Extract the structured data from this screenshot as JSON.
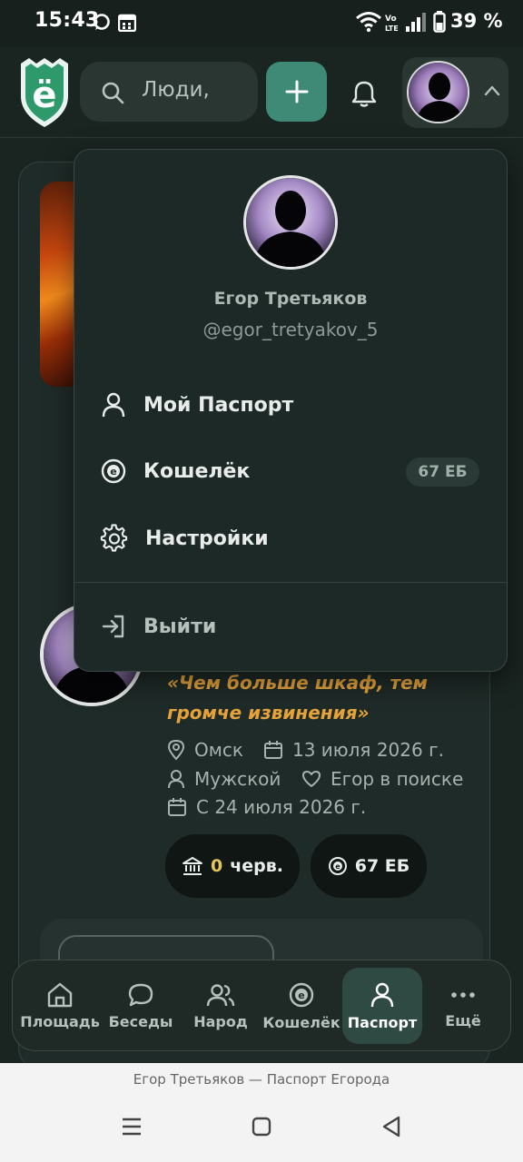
{
  "status_bar": {
    "time": "15:43",
    "battery": "39 %"
  },
  "header": {
    "search_placeholder": "Люди,",
    "logo_letter": "ё"
  },
  "profile": {
    "quote": "«Чем больше шкаф, тем громче извинения»",
    "city": "Омск",
    "date": "13 июля 2026 г.",
    "gender": "Мужской",
    "looking_for": "Егор в поиске",
    "since": "С 24 июля 2026 г.",
    "treasury_value": "0",
    "treasury_unit": "черв.",
    "wallet_balance": "67 ЕБ"
  },
  "dropdown": {
    "name": "Егор Третьяков",
    "handle": "@egor_tretyakov_5",
    "items": [
      {
        "label": "Мой Паспорт",
        "icon": "user-icon"
      },
      {
        "label": "Кошелёк",
        "icon": "coin-icon",
        "badge": "67 ЕБ"
      },
      {
        "label": "Настройки",
        "icon": "gear-icon"
      }
    ],
    "logout_label": "Выйти"
  },
  "bottom_nav": {
    "items": [
      {
        "label": "Площадь",
        "icon": "home-icon"
      },
      {
        "label": "Беседы",
        "icon": "chat-icon"
      },
      {
        "label": "Народ",
        "icon": "people-icon"
      },
      {
        "label": "Кошелёк",
        "icon": "coin-icon"
      },
      {
        "label": "Паспорт",
        "icon": "user-icon",
        "active": true
      },
      {
        "label": "Ещё",
        "icon": "more-icon"
      }
    ]
  },
  "browser": {
    "page_title": "Егор Третьяков — Паспорт Егорода"
  },
  "colors": {
    "accent": "#3e8a76",
    "quote": "#e6a33c",
    "background": "#1a2421"
  }
}
